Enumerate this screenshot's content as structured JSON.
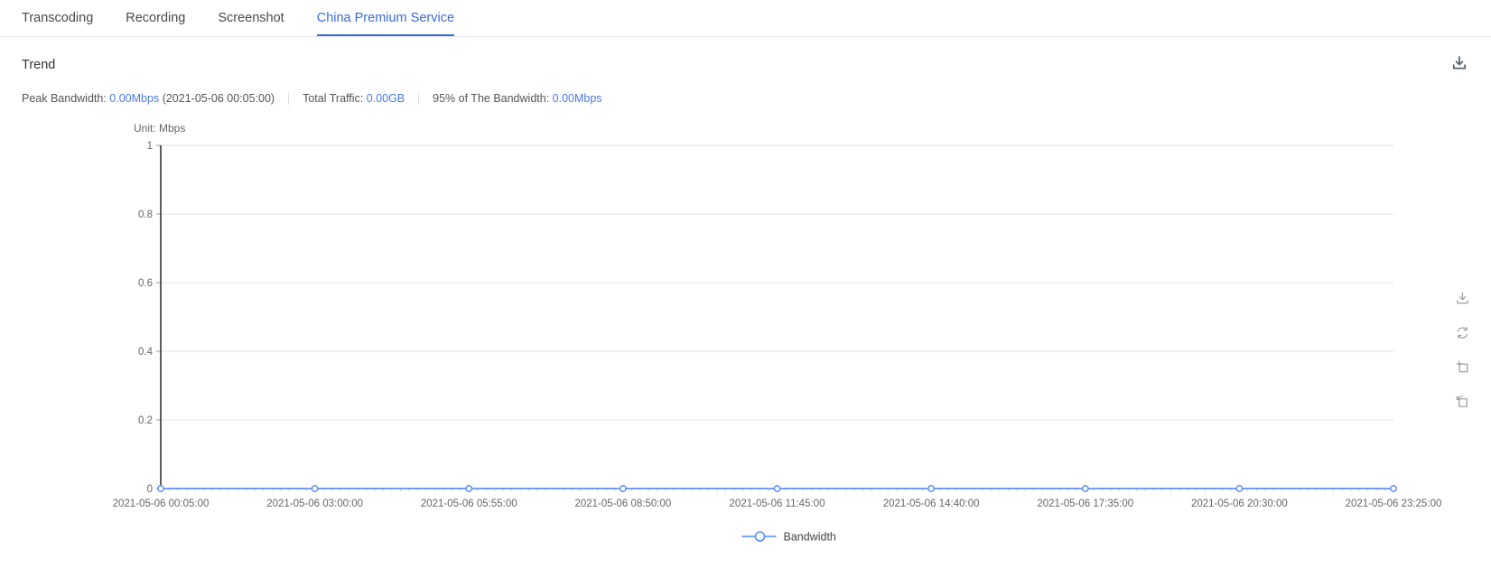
{
  "tabs": [
    {
      "label": "Transcoding",
      "active": false
    },
    {
      "label": "Recording",
      "active": false
    },
    {
      "label": "Screenshot",
      "active": false
    },
    {
      "label": "China Premium Service",
      "active": true
    }
  ],
  "panel": {
    "title": "Trend",
    "download_icon": "download-icon"
  },
  "stats": {
    "peak_label": "Peak Bandwidth:",
    "peak_value": "0.00Mbps",
    "peak_time": "(2021-05-06 00:05:00)",
    "traffic_label": "Total Traffic:",
    "traffic_value": "0.00GB",
    "p95_label": "95% of The Bandwidth:",
    "p95_value": "0.00Mbps"
  },
  "chart_data": {
    "type": "line",
    "title": "Trend",
    "unit_label": "Unit: Mbps",
    "xlabel": "",
    "ylabel": "Mbps",
    "ylim": [
      0,
      1
    ],
    "yticks": [
      "0",
      "0.2",
      "0.4",
      "0.6",
      "0.8",
      "1"
    ],
    "grid": true,
    "legend_position": "bottom",
    "series": [
      {
        "name": "Bandwidth",
        "color": "#5b8ff9",
        "values": [
          0,
          0,
          0,
          0,
          0,
          0,
          0,
          0,
          0
        ]
      }
    ],
    "categories": [
      "2021-05-06 00:05:00",
      "2021-05-06 03:00:00",
      "2021-05-06 05:55:00",
      "2021-05-06 08:50:00",
      "2021-05-06 11:45:00",
      "2021-05-06 14:40:00",
      "2021-05-06 17:35:00",
      "2021-05-06 20:30:00",
      "2021-05-06 23:25:00"
    ]
  },
  "toolbar": {
    "items": [
      {
        "name": "download-icon",
        "tooltip": "Download"
      },
      {
        "name": "refresh-icon",
        "tooltip": "Refresh"
      },
      {
        "name": "zoom-select-icon",
        "tooltip": "Area Zoom"
      },
      {
        "name": "restore-icon",
        "tooltip": "Restore"
      }
    ]
  },
  "colors": {
    "accent": "#3a6ae0",
    "link": "#4a7ae8",
    "series": "#5b8ff9",
    "grid": "#e0e0e0",
    "axis": "#333333"
  }
}
